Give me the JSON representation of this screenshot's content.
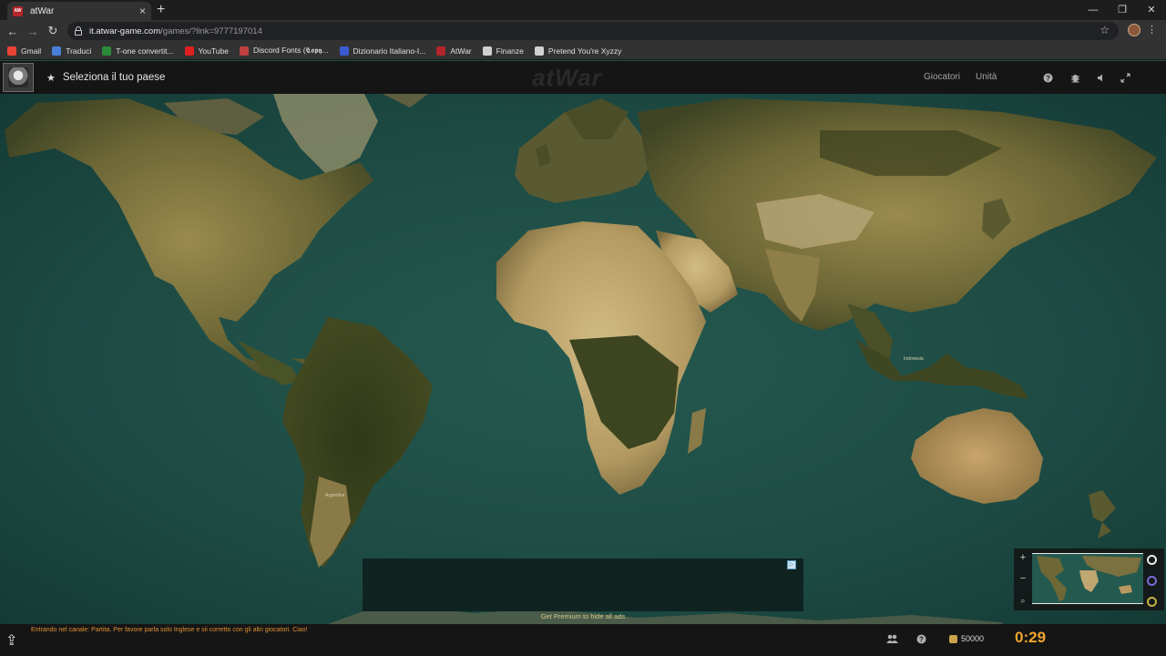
{
  "browser": {
    "tab_title": "atWar",
    "tab_favicon_text": "AW",
    "url_host": "it.atwar-game.com",
    "url_path": "/games/?link=9777197014",
    "bookmarks": [
      {
        "label": "Gmail",
        "icon": "gmail-icon",
        "color": "#ea4335"
      },
      {
        "label": "Traduci",
        "icon": "translate-icon",
        "color": "#4a7fd8"
      },
      {
        "label": "T-one convertit...",
        "icon": "bookmark-icon",
        "color": "#2a8a3a"
      },
      {
        "label": "YouTube",
        "icon": "youtube-icon",
        "color": "#e02020"
      },
      {
        "label": "Discord Fonts (𝕮𝖔𝖕𝖞...",
        "icon": "bookmark-icon",
        "color": "#c04040"
      },
      {
        "label": "Dizionario Italiano-I...",
        "icon": "bookmark-icon",
        "color": "#3a5ad0"
      },
      {
        "label": "AtWar",
        "icon": "atwar-icon",
        "color": "#b3252a"
      },
      {
        "label": "Finanze",
        "icon": "globe-icon",
        "color": "#d0d0d0"
      },
      {
        "label": "Pretend You're Xyzzy",
        "icon": "globe-icon",
        "color": "#d0d0d0"
      }
    ]
  },
  "game": {
    "header": {
      "title": "Seleziona il tuo paese",
      "logo_text": "atWar",
      "links": [
        "Giocatori",
        "Unità"
      ],
      "icons": [
        "help-icon",
        "bug-icon",
        "sound-icon",
        "fullscreen-icon"
      ]
    },
    "map": {
      "labels": [
        "Argentina",
        "Indonesia"
      ]
    },
    "ad": {
      "premium_text": "Get Premium to hide all ads"
    },
    "bottom": {
      "chat_message": "Entrando nel canale: Partita. Per favore parla solo Inglese e sii corretto con gli altri giocatori. Ciao!",
      "gold": "50000",
      "timer": "0:29"
    },
    "colors": {
      "ocean": "#1f5049",
      "land": "#8a7d46",
      "timer": "#f0a52c",
      "chat": "#e09030"
    }
  }
}
